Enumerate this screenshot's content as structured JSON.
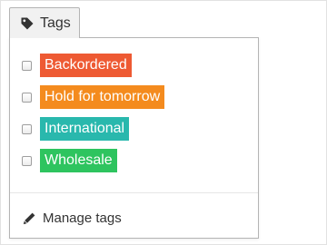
{
  "tags_button": {
    "label": "Tags",
    "icon": "tag-icon"
  },
  "dropdown": {
    "tags": [
      {
        "label": "Backordered",
        "color": "#ee5a33",
        "checked": false
      },
      {
        "label": "Hold for tomorrow",
        "color": "#f48b1e",
        "checked": false
      },
      {
        "label": "International",
        "color": "#29b8ad",
        "checked": false
      },
      {
        "label": "Wholesale",
        "color": "#2ec45f",
        "checked": false
      }
    ],
    "manage": {
      "label": "Manage tags",
      "icon": "pencil-icon"
    }
  }
}
